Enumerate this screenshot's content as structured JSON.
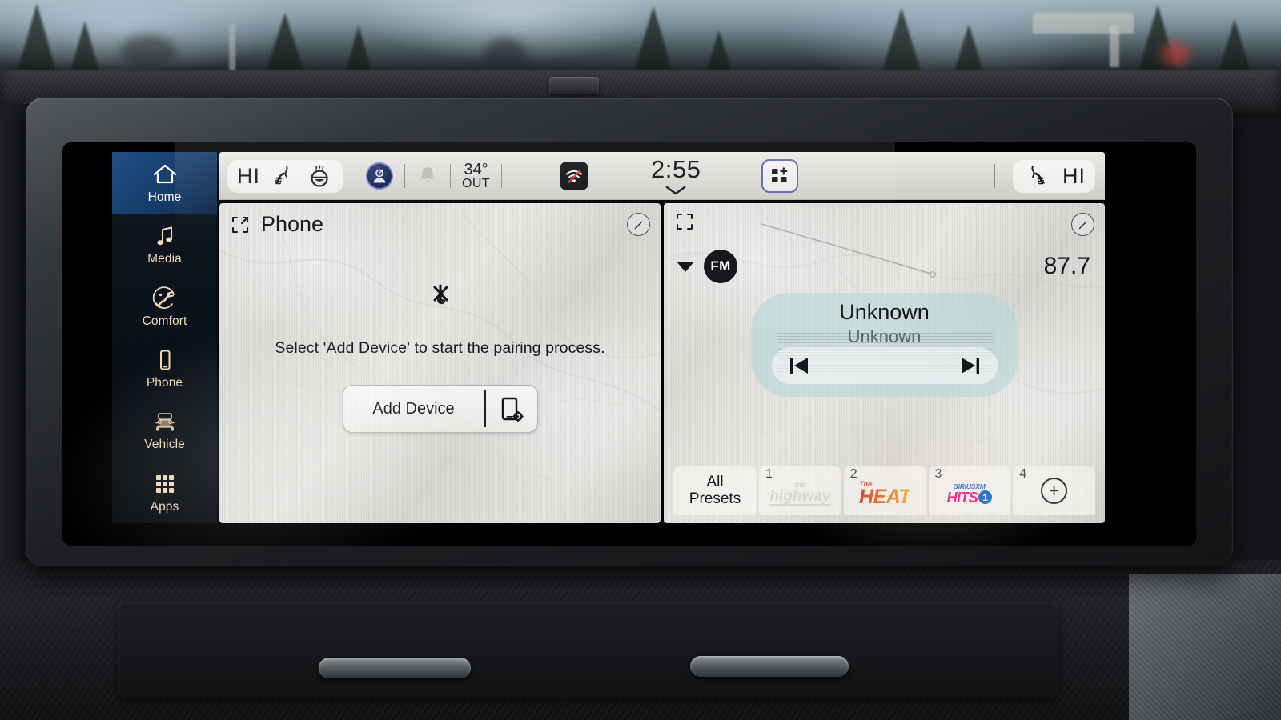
{
  "statusbar": {
    "left_climate_level": "HI",
    "heated_seat_icon": "heated-seat-icon",
    "heated_steering_icon": "heated-steering-wheel-icon",
    "profile_icon": "driver-profile-icon",
    "notification_icon": "bell-icon",
    "temperature": "34°",
    "temperature_label": "OUT",
    "wifi_icon": "wifi-off-icon",
    "clock": "2:55",
    "clock_caret_icon": "chevron-down-icon",
    "apps_icon": "add-widget-icon",
    "right_heated_seat_icon": "heated-seat-icon",
    "right_climate_level": "HI"
  },
  "sidebar": {
    "items": [
      {
        "label": "Home",
        "icon": "home-icon",
        "active": true
      },
      {
        "label": "Media",
        "icon": "music-note-icon",
        "active": false
      },
      {
        "label": "Comfort",
        "icon": "comfort-seat-icon",
        "active": false
      },
      {
        "label": "Phone",
        "icon": "phone-device-icon",
        "active": false
      },
      {
        "label": "Vehicle",
        "icon": "jeep-icon",
        "active": false
      },
      {
        "label": "Apps",
        "icon": "apps-grid-icon",
        "active": false
      }
    ]
  },
  "phone_card": {
    "title": "Phone",
    "expand_icon": "expand-icon",
    "edit_icon": "edit-pencil-icon",
    "status_icon": "bluetooth-phone-disconnected-icon",
    "message": "Select 'Add Device' to start the pairing process.",
    "add_device_label": "Add Device",
    "add_device_icon": "phone-settings-icon"
  },
  "radio_card": {
    "expand_icon": "expand-icon",
    "edit_icon": "edit-pencil-icon",
    "band_caret_icon": "caret-down-icon",
    "band": "FM",
    "frequency": "87.7",
    "now_playing_title": "Unknown",
    "now_playing_subtitle": "Unknown",
    "prev_icon": "skip-previous-icon",
    "next_icon": "skip-next-icon",
    "presets_label_line1": "All",
    "presets_label_line2": "Presets",
    "presets": [
      {
        "number": "1",
        "logo": "the-highway-logo",
        "logo_text_small": "the",
        "logo_text_main": "highway"
      },
      {
        "number": "2",
        "logo": "the-heat-logo",
        "logo_text_small": "The",
        "logo_text_main": "HEAT"
      },
      {
        "number": "3",
        "logo": "siriusxm-hits-1-logo",
        "logo_text_small": "SIRIUSXM",
        "logo_text_main": "HITS",
        "logo_badge": "1"
      },
      {
        "number": "4",
        "logo": "add-preset-icon",
        "logo_text_main": "+"
      }
    ]
  },
  "pagination": {
    "dots": [
      true,
      false,
      false
    ],
    "add_page_icon": "add-page-icon"
  },
  "colors": {
    "sidebar_bg": "#0a1017",
    "sidebar_active": "#1f4f86",
    "sidebar_icon": "#f0d9b8",
    "card_bg": "#e3e2df",
    "statusbar_bg": "#dedcd8",
    "accent_blue": "#5d66b5",
    "now_playing_bg": "#b7d6d5",
    "heat_logo": "#e06a1e",
    "hits1_magenta": "#e8197f",
    "hits1_blue": "#1b62c9"
  }
}
